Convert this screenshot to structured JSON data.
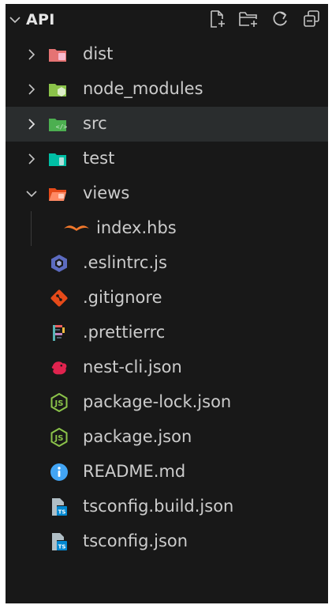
{
  "explorer": {
    "title": "API",
    "actions": [
      {
        "name": "new-file-icon"
      },
      {
        "name": "new-folder-icon"
      },
      {
        "name": "refresh-icon"
      },
      {
        "name": "collapse-all-icon"
      }
    ]
  },
  "tree": {
    "items": [
      {
        "label": "dist",
        "kind": "folder",
        "icon": "folder-dist-icon",
        "color": "#e57373"
      },
      {
        "label": "node_modules",
        "kind": "folder",
        "icon": "folder-node-icon",
        "color": "#8bc34a"
      },
      {
        "label": "src",
        "kind": "folder",
        "icon": "folder-src-icon",
        "color": "#4caf50"
      },
      {
        "label": "test",
        "kind": "folder",
        "icon": "folder-test-icon",
        "color": "#00bfa5"
      },
      {
        "label": "views",
        "kind": "folder",
        "icon": "folder-views-icon",
        "color": "#ff7043"
      },
      {
        "label": "index.hbs",
        "kind": "file",
        "icon": "handlebars-icon",
        "color": "#f0772b"
      },
      {
        "label": ".eslintrc.js",
        "kind": "file",
        "icon": "eslint-icon",
        "color": "#5c6bc0"
      },
      {
        "label": ".gitignore",
        "kind": "file",
        "icon": "git-icon",
        "color": "#e64a19"
      },
      {
        "label": ".prettierrc",
        "kind": "file",
        "icon": "prettier-icon",
        "color": "#56b3b4"
      },
      {
        "label": "nest-cli.json",
        "kind": "file",
        "icon": "nestjs-icon",
        "color": "#e0234e"
      },
      {
        "label": "package-lock.json",
        "kind": "file",
        "icon": "nodejs-icon",
        "color": "#8bc34a"
      },
      {
        "label": "package.json",
        "kind": "file",
        "icon": "nodejs-icon",
        "color": "#8bc34a"
      },
      {
        "label": "README.md",
        "kind": "file",
        "icon": "info-icon",
        "color": "#42a5f5"
      },
      {
        "label": "tsconfig.build.json",
        "kind": "file",
        "icon": "tsconfig-icon",
        "color": "#0288d1"
      },
      {
        "label": "tsconfig.json",
        "kind": "file",
        "icon": "tsconfig-icon",
        "color": "#0288d1"
      }
    ]
  },
  "colors": {
    "background": "#181818",
    "selected_row": "#2a2d2e",
    "text": "#cccccc",
    "muted_icon": "#c5c5c5"
  }
}
